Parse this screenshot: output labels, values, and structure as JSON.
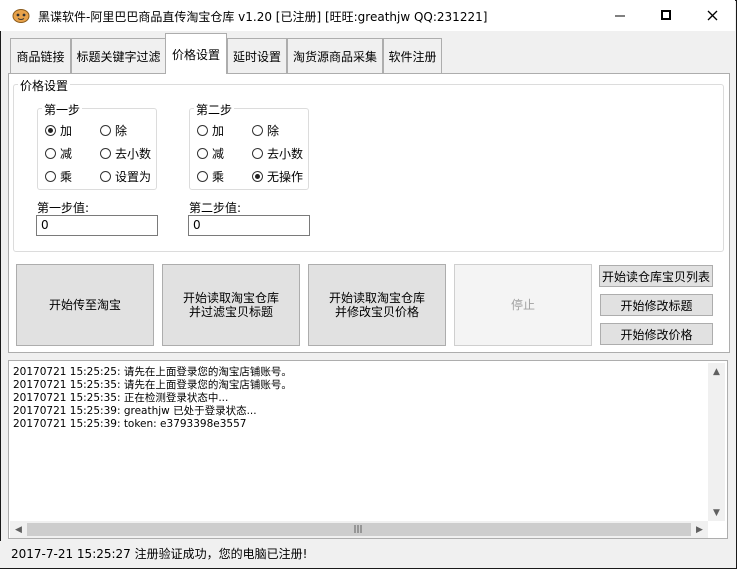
{
  "window": {
    "title": "黑谍软件-阿里巴巴商品直传淘宝仓库  v1.20 [已注册] [旺旺:greathjw QQ:231221]",
    "controls": {
      "minimize": "—",
      "maximize": "☐",
      "close": "✕"
    }
  },
  "tabs": [
    {
      "label": "商品链接",
      "active": false
    },
    {
      "label": "标题关键字过滤",
      "active": false
    },
    {
      "label": "价格设置",
      "active": true
    },
    {
      "label": "延时设置",
      "active": false
    },
    {
      "label": "淘货源商品采集",
      "active": false
    },
    {
      "label": "软件注册",
      "active": false
    }
  ],
  "price_settings": {
    "group_label": "价格设置",
    "step1": {
      "label": "第一步",
      "options": [
        {
          "label": "加",
          "checked": true
        },
        {
          "label": "除",
          "checked": false
        },
        {
          "label": "减",
          "checked": false
        },
        {
          "label": "去小数",
          "checked": false
        },
        {
          "label": "乘",
          "checked": false
        },
        {
          "label": "设置为",
          "checked": false
        }
      ],
      "value_label": "第一步值:",
      "value": "0"
    },
    "step2": {
      "label": "第二步",
      "options": [
        {
          "label": "加",
          "checked": false
        },
        {
          "label": "除",
          "checked": false
        },
        {
          "label": "减",
          "checked": false
        },
        {
          "label": "去小数",
          "checked": false
        },
        {
          "label": "乘",
          "checked": false
        },
        {
          "label": "无操作",
          "checked": true
        }
      ],
      "value_label": "第二步值:",
      "value": "0"
    }
  },
  "actions": {
    "upload": "开始传至淘宝",
    "read_filter": [
      "开始读取淘宝仓库",
      "并过滤宝贝标题"
    ],
    "read_price": [
      "开始读取淘宝仓库",
      "并修改宝贝价格"
    ],
    "stop": "停止",
    "read_list": "开始读仓库宝贝列表",
    "edit_title": "开始修改标题",
    "edit_price": "开始修改价格"
  },
  "log": [
    "20170721 15:25:25:  请先在上面登录您的淘宝店铺账号。",
    "20170721 15:25:35:  请先在上面登录您的淘宝店铺账号。",
    "20170721 15:25:35:  正在检测登录状态中...",
    "20170721 15:25:39:  greathjw 已处于登录状态...",
    "20170721 15:25:39:  token: e3793398e3557"
  ],
  "status": "2017-7-21 15:25:27  注册验证成功，您的电脑已注册!"
}
